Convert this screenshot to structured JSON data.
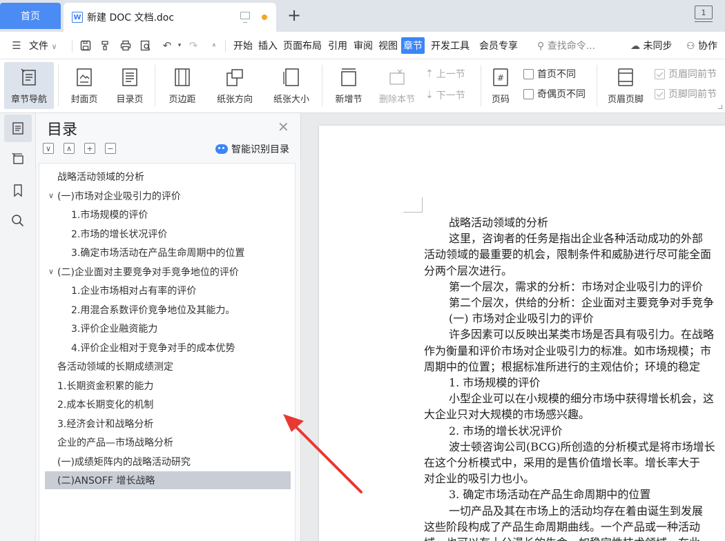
{
  "tabs": {
    "home": "首页",
    "doc": "新建 DOC 文档.doc",
    "doc_icon": "W",
    "new": "+",
    "window": "1"
  },
  "menu": {
    "file": "文件",
    "items": [
      "开始",
      "插入",
      "页面布局",
      "引用",
      "审阅",
      "视图",
      "章节",
      "开发工具",
      "会员专享"
    ],
    "active_index": 6,
    "search": "查找命令...",
    "sync": "未同步",
    "collab": "协作"
  },
  "ribbon": {
    "chapter_nav": "章节导航",
    "cover": "封面页",
    "toc_page": "目录页",
    "margin": "页边距",
    "orientation": "纸张方向",
    "size": "纸张大小",
    "new_section": "新增节",
    "delete_section": "删除本节",
    "prev_section": "上一节",
    "next_section": "下一节",
    "page_number": "页码",
    "first_diff": "首页不同",
    "odd_even_diff": "奇偶页不同",
    "header_footer": "页眉页脚",
    "header_same": "页眉同前节",
    "footer_same": "页脚同前节"
  },
  "toc": {
    "title": "目录",
    "smart": "智能识别目录",
    "items": [
      {
        "text": "战略活动领域的分析",
        "level": 1,
        "caret": ""
      },
      {
        "text": "(一)市场对企业吸引力的评价",
        "level": 1,
        "caret": "∨"
      },
      {
        "text": "1.市场规模的评价",
        "level": 2,
        "caret": ""
      },
      {
        "text": "2.市场的增长状况评价",
        "level": 2,
        "caret": ""
      },
      {
        "text": "3.确定市场活动在产品生命周期中的位置",
        "level": 2,
        "caret": ""
      },
      {
        "text": "(二)企业面对主要竞争对手竞争地位的评价",
        "level": 1,
        "caret": "∨"
      },
      {
        "text": "1.企业市场相对占有率的评价",
        "level": 2,
        "caret": ""
      },
      {
        "text": "2.用混合系数评价竞争地位及其能力。",
        "level": 2,
        "caret": ""
      },
      {
        "text": "3.评价企业融资能力",
        "level": 2,
        "caret": ""
      },
      {
        "text": "4.评价企业相对于竞争对手的成本优势",
        "level": 2,
        "caret": ""
      },
      {
        "text": "各活动领域的长期成绩测定",
        "level": 1,
        "caret": ""
      },
      {
        "text": "1.长期资金积累的能力",
        "level": 1,
        "caret": ""
      },
      {
        "text": "2.成本长期变化的机制",
        "level": 1,
        "caret": ""
      },
      {
        "text": "3.经济会计和战略分析",
        "level": 1,
        "caret": ""
      },
      {
        "text": "企业的产品—市场战略分析",
        "level": 1,
        "caret": ""
      },
      {
        "text": "(一)成绩矩阵内的战略活动研究",
        "level": 1,
        "caret": ""
      },
      {
        "text": "(二)ANSOFF 增长战略",
        "level": 1,
        "caret": "",
        "selected": true
      }
    ]
  },
  "document": {
    "lines": [
      "战略活动领域的分析",
      "这里，咨询者的任务是指出企业各种活动成功的外部",
      "活动领域的最重要的机会，限制条件和威胁进行尽可能全面",
      "分两个层次进行。",
      "第一个层次，需求的分析：市场对企业吸引力的评价",
      "第二个层次，供给的分析：企业面对主要竞争对手竞争",
      "(一) 市场对企业吸引力的评价",
      "许多因素可以反映出某类市场是否具有吸引力。在战略",
      "作为衡量和评价市场对企业吸引力的标准。如市场规模；市",
      "周期中的位置；根据标准所进行的主观估价；环境的稳定",
      "1. 市场规模的评价",
      "小型企业可以在小规模的细分市场中获得增长机会，这",
      "大企业只对大规模的市场感兴趣。",
      "2. 市场的增长状况评价",
      "波士顿咨询公司(BCG)所创造的分析模式是将市场增长",
      "在这个分析模式中，采用的是售价值增长率。增长率大于",
      "对企业的吸引力也小。",
      "3. 确定市场活动在产品生命周期中的位置",
      "一切产品及其在市场上的活动均存在着由诞生到发展",
      "这些阶段构成了产品生命周期曲线。一个产品或一种活动",
      "域，也可以有十分漫长的生命，如稳定性技术领域，在此"
    ],
    "indented": [
      0,
      1,
      4,
      5,
      6,
      7,
      10,
      11,
      13,
      14,
      17,
      18
    ]
  },
  "colors": {
    "accent": "#3b86f7",
    "arrow": "#e83a32"
  }
}
